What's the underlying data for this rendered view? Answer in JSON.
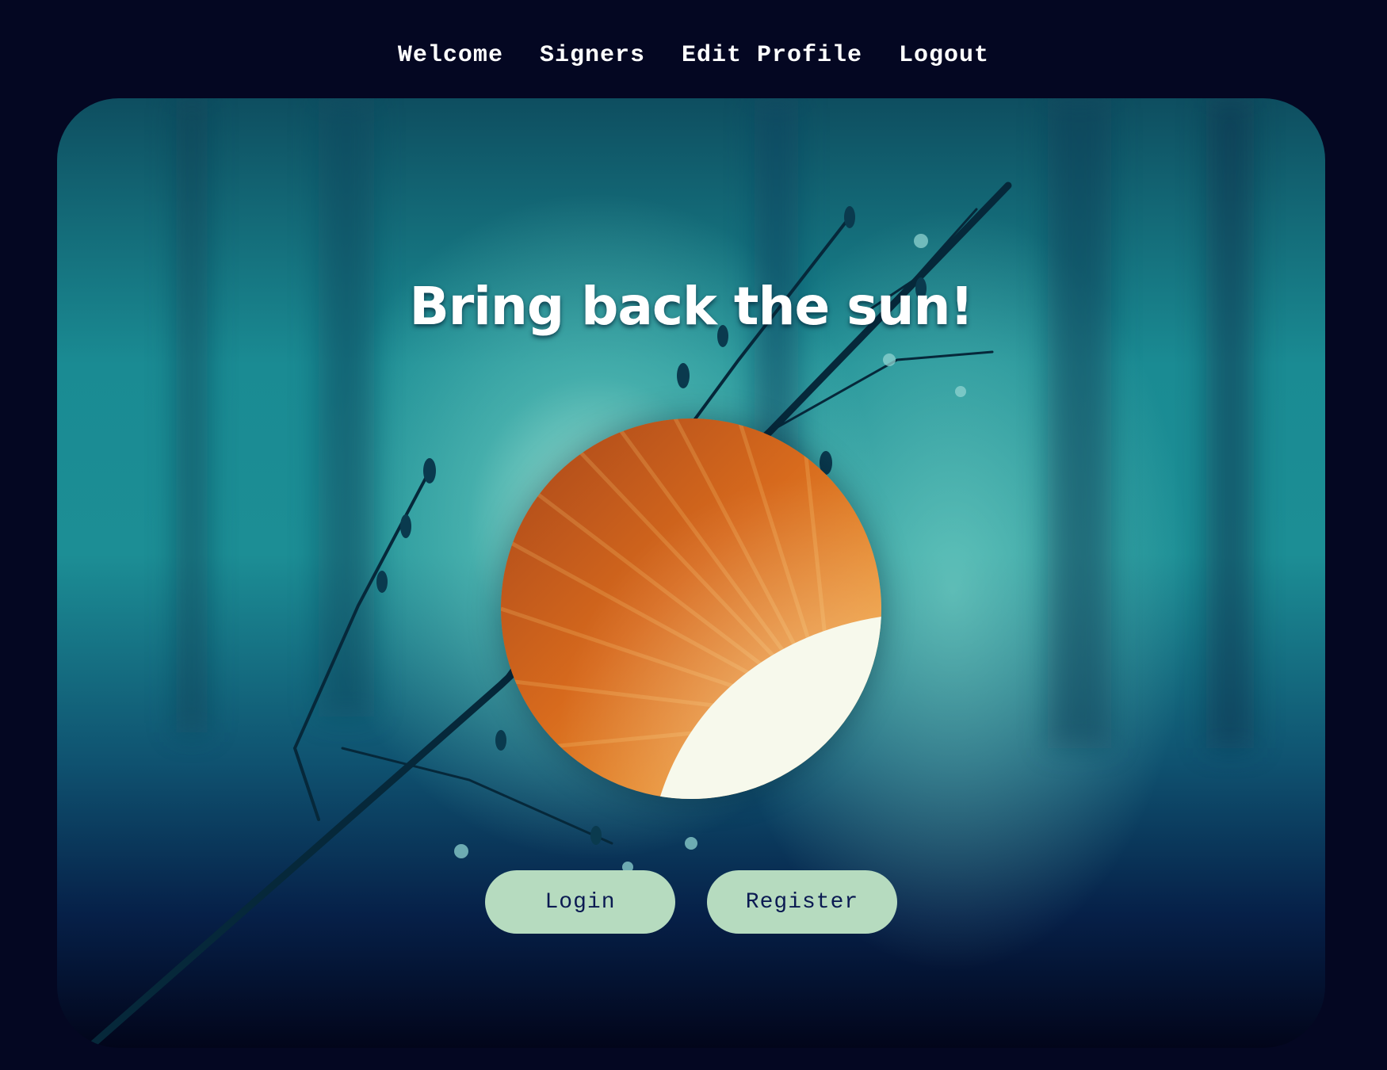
{
  "nav": {
    "items": [
      {
        "label": "Welcome"
      },
      {
        "label": "Signers"
      },
      {
        "label": "Edit Profile"
      },
      {
        "label": "Logout"
      }
    ]
  },
  "hero": {
    "title": "Bring back the sun!",
    "image": "sun-icon"
  },
  "actions": {
    "login_label": "Login",
    "register_label": "Register"
  },
  "colors": {
    "page_background": "#040722",
    "button_background": "#b6dbbf",
    "button_text": "#0b1a52",
    "sun_orange": "#d9751f"
  }
}
